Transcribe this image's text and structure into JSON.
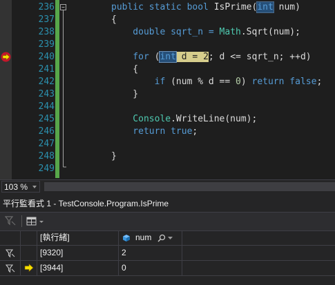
{
  "editor": {
    "line_numbers": [
      "236",
      "237",
      "238",
      "239",
      "240",
      "241",
      "242",
      "243",
      "244",
      "245",
      "246",
      "247",
      "248",
      "249"
    ],
    "code": {
      "l236": {
        "pre": "public static bool ",
        "method": "IsPrime",
        "paren": "(",
        "type": "int",
        "post": " num)"
      },
      "l237": "{",
      "l238": {
        "pre": "    double sqrt_n = ",
        "cls": "Math",
        "post": ".Sqrt(num);"
      },
      "l239": "",
      "l240": {
        "kw": "    for ",
        "paren": "(",
        "type": "int",
        "stmt_rest": " d = ",
        "init": "2",
        "post": "; d <= sqrt_n; ++d)"
      },
      "l241": "    {",
      "l242": {
        "kw": "        if ",
        "cond_pre": "(num % d == ",
        "zero": "0",
        "cond_post": ") ",
        "ret": "return ",
        "val": "false",
        "end": ";"
      },
      "l243": "    }",
      "l244": "",
      "l245": {
        "cls": "    Console",
        "post": ".WriteLine(num);"
      },
      "l246": {
        "ret": "    return ",
        "val": "true",
        "end": ";"
      },
      "l247": "",
      "l248": "}",
      "l249": ""
    }
  },
  "zoom": {
    "value": "103 %"
  },
  "watch": {
    "title": "平行監看式 1 - TestConsole.Program.IsPrime",
    "columns": {
      "thread": "[執行緒]",
      "var": "num"
    },
    "rows": [
      {
        "thread": "[9320]",
        "value": "2",
        "current": false
      },
      {
        "thread": "[3944]",
        "value": "0",
        "current": true
      }
    ]
  },
  "icons": {
    "breakpoint": "current-statement-breakpoint-icon",
    "filter": "flag-filter-icon",
    "grid": "grid-layout-icon",
    "search": "search-icon",
    "variable": "variable-cube-icon",
    "arrow": "current-thread-arrow-icon"
  },
  "colors": {
    "keyword": "#569cd6",
    "class": "#4ec9b0",
    "number": "#b5cea8",
    "line_number": "#2b91af",
    "highlight": "#d6cd8c",
    "changed": "#57a64a"
  }
}
